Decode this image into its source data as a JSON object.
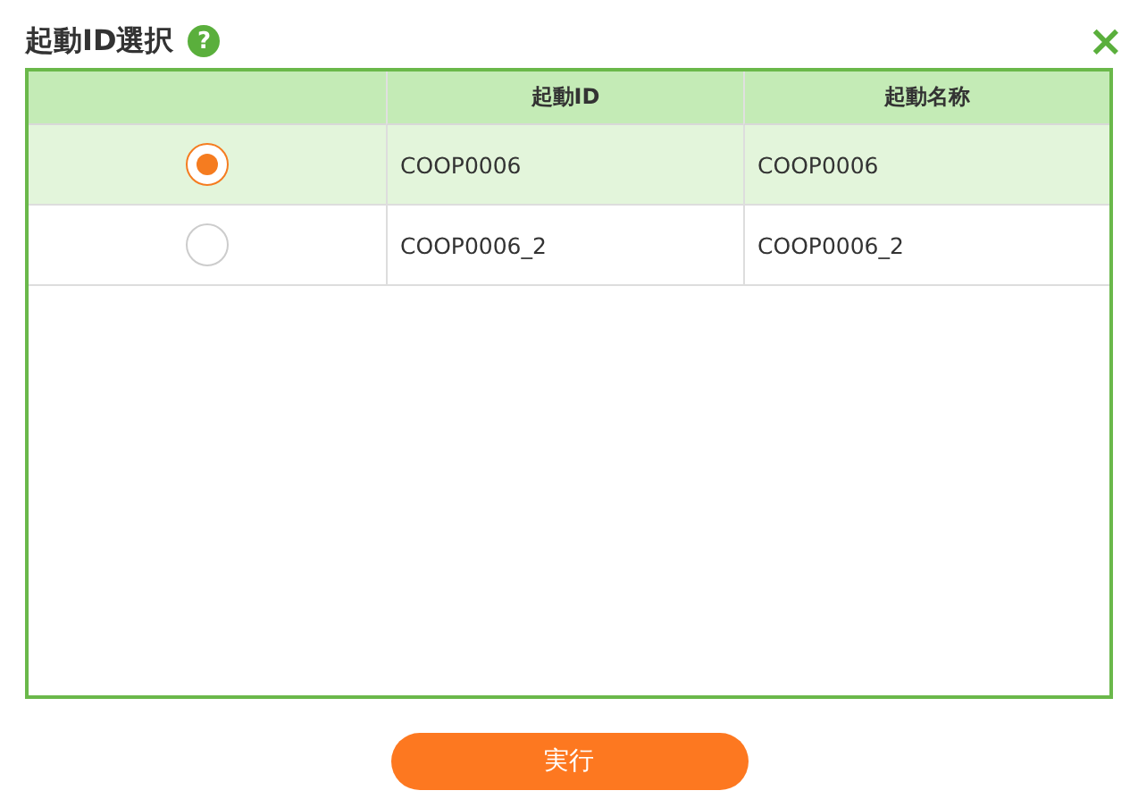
{
  "dialog": {
    "title": "起動ID選択",
    "help_icon": "?",
    "close_icon": "×"
  },
  "table": {
    "columns": [
      {
        "label": "起動ID"
      },
      {
        "label": "起動名称"
      }
    ],
    "rows": [
      {
        "selected": true,
        "id": "COOP0006",
        "name": "COOP0006"
      },
      {
        "selected": false,
        "id": "COOP0006_2",
        "name": "COOP0006_2"
      }
    ]
  },
  "buttons": [
    {
      "label": "実行"
    }
  ]
}
